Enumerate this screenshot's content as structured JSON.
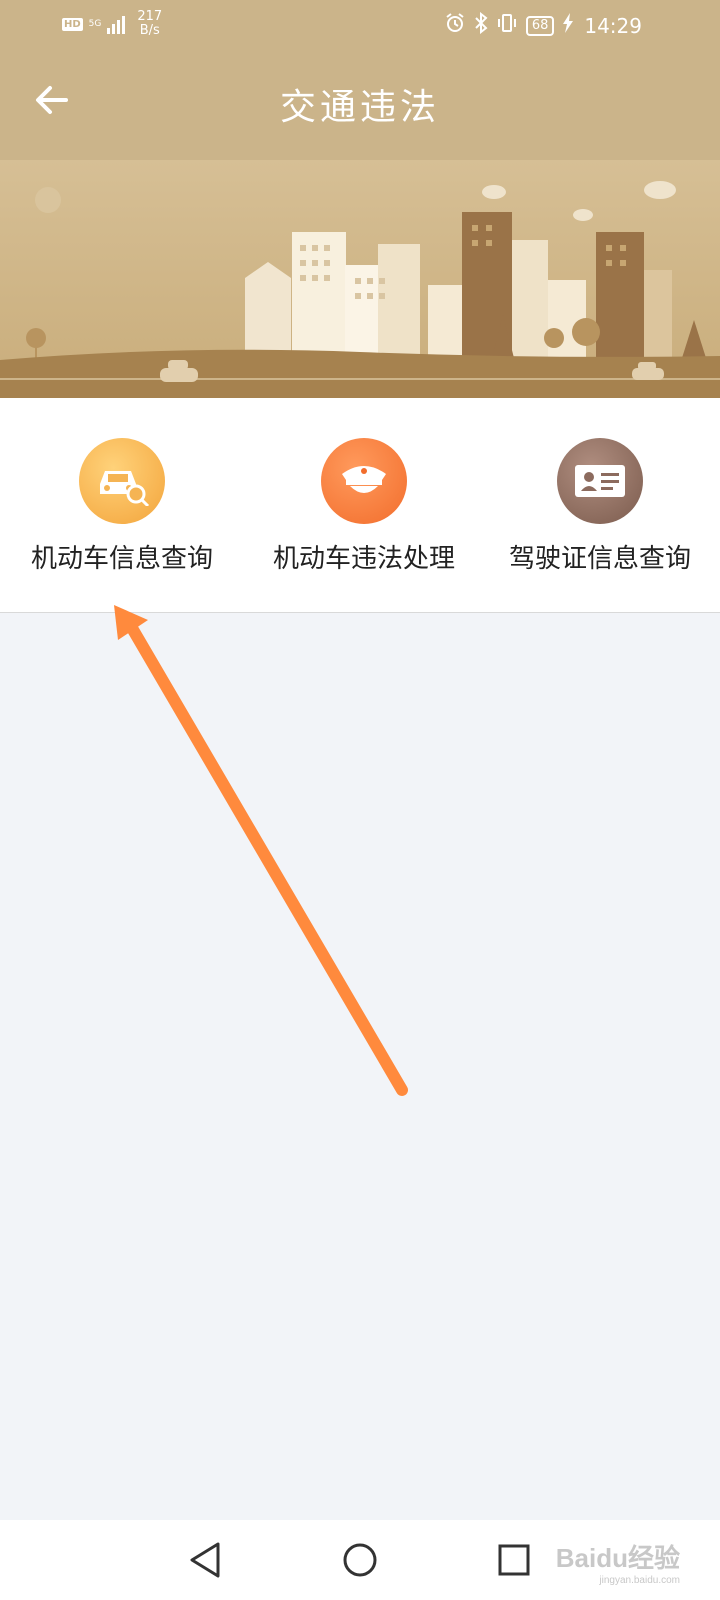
{
  "status_bar": {
    "hd_badge": "HD",
    "network": "5G",
    "speed_value": "217",
    "speed_unit": "B/s",
    "battery": "68",
    "time": "14:29"
  },
  "header": {
    "title": "交通违法"
  },
  "menu": [
    {
      "label": "机动车信息查询",
      "icon": "car-search-icon",
      "color_from": "#ffd27a",
      "color_to": "#f3a43b"
    },
    {
      "label": "机动车违法处理",
      "icon": "police-cap-icon",
      "color_from": "#ff9a5c",
      "color_to": "#f26d2c"
    },
    {
      "label": "驾驶证信息查询",
      "icon": "id-card-icon",
      "color_from": "#b08e80",
      "color_to": "#7b5b4d"
    }
  ],
  "watermark": {
    "brand": "Baidu经验",
    "url": "jingyan.baidu.com"
  },
  "colors": {
    "header_bg": "#cbb48a",
    "page_bg": "#f2f4f8",
    "annotation_arrow": "#ff8a3d"
  }
}
